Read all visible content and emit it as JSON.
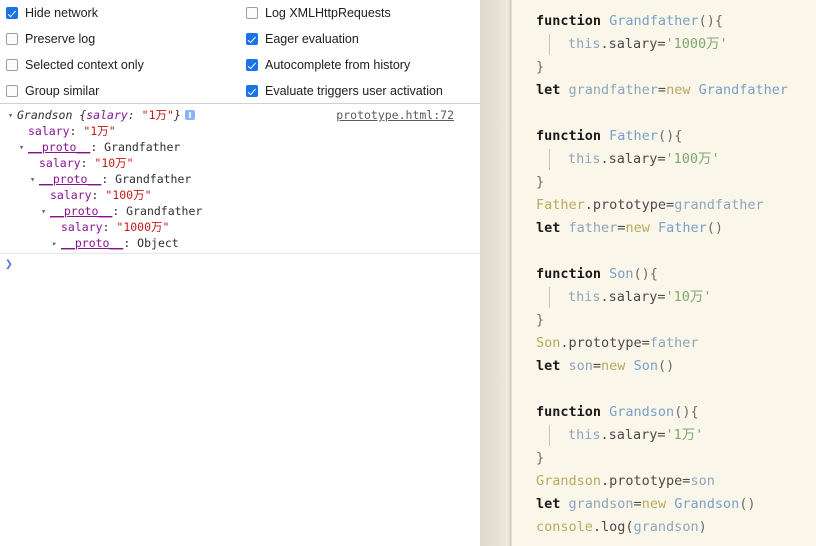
{
  "devtools": {
    "settings": {
      "left_column": [
        {
          "label": "Hide network",
          "checked": true,
          "name": "hide-network"
        },
        {
          "label": "Preserve log",
          "checked": false,
          "name": "preserve-log"
        },
        {
          "label": "Selected context only",
          "checked": false,
          "name": "selected-context-only"
        },
        {
          "label": "Group similar",
          "checked": false,
          "name": "group-similar"
        }
      ],
      "right_column": [
        {
          "label": "Log XMLHttpRequests",
          "checked": false,
          "name": "log-xmlhttprequests"
        },
        {
          "label": "Eager evaluation",
          "checked": true,
          "name": "eager-evaluation"
        },
        {
          "label": "Autocomplete from history",
          "checked": true,
          "name": "autocomplete-from-history"
        },
        {
          "label": "Evaluate triggers user activation",
          "checked": true,
          "name": "evaluate-triggers-user-activation"
        }
      ]
    },
    "log": {
      "source_link": "prototype.html:72",
      "rows": [
        {
          "indent": 0,
          "twisty": "▾",
          "segments": [
            {
              "text": "Grandson ",
              "cls": "obj-name"
            },
            {
              "text": "{",
              "cls": "brace"
            },
            {
              "text": "salary",
              "cls": "prop-key-italic"
            },
            {
              "text": ": ",
              "cls": "brace"
            },
            {
              "text": "\"1万\"",
              "cls": "str-val"
            },
            {
              "text": "}",
              "cls": "brace"
            }
          ],
          "info_icon": true
        },
        {
          "indent": 1,
          "twisty": "",
          "segments": [
            {
              "text": "salary",
              "cls": "prop-key"
            },
            {
              "text": ": ",
              "cls": "proto-val"
            },
            {
              "text": "\"1万\"",
              "cls": "str-val"
            }
          ],
          "info_icon": false
        },
        {
          "indent": 1,
          "twisty": "▾",
          "segments": [
            {
              "text": "__proto__",
              "cls": "proto-key"
            },
            {
              "text": ": ",
              "cls": "proto-val"
            },
            {
              "text": "Grandfather",
              "cls": "proto-val"
            }
          ],
          "info_icon": false
        },
        {
          "indent": 2,
          "twisty": "",
          "segments": [
            {
              "text": "salary",
              "cls": "prop-key"
            },
            {
              "text": ": ",
              "cls": "proto-val"
            },
            {
              "text": "\"10万\"",
              "cls": "str-val"
            }
          ],
          "info_icon": false
        },
        {
          "indent": 2,
          "twisty": "▾",
          "segments": [
            {
              "text": "__proto__",
              "cls": "proto-key"
            },
            {
              "text": ": ",
              "cls": "proto-val"
            },
            {
              "text": "Grandfather",
              "cls": "proto-val"
            }
          ],
          "info_icon": false
        },
        {
          "indent": 3,
          "twisty": "",
          "segments": [
            {
              "text": "salary",
              "cls": "prop-key"
            },
            {
              "text": ": ",
              "cls": "proto-val"
            },
            {
              "text": "\"100万\"",
              "cls": "str-val"
            }
          ],
          "info_icon": false
        },
        {
          "indent": 3,
          "twisty": "▾",
          "segments": [
            {
              "text": "__proto__",
              "cls": "proto-key"
            },
            {
              "text": ": ",
              "cls": "proto-val"
            },
            {
              "text": "Grandfather",
              "cls": "proto-val"
            }
          ],
          "info_icon": false
        },
        {
          "indent": 4,
          "twisty": "",
          "segments": [
            {
              "text": "salary",
              "cls": "prop-key"
            },
            {
              "text": ": ",
              "cls": "proto-val"
            },
            {
              "text": "\"1000万\"",
              "cls": "str-val"
            }
          ],
          "info_icon": false
        },
        {
          "indent": 4,
          "twisty": "▸",
          "segments": [
            {
              "text": "__proto__",
              "cls": "proto-key"
            },
            {
              "text": ": ",
              "cls": "proto-val"
            },
            {
              "text": "Object",
              "cls": "proto-val"
            }
          ],
          "info_icon": false
        }
      ]
    },
    "prompt": {
      "arrow": "❯",
      "value": ""
    }
  },
  "editor": {
    "lines": [
      {
        "indent": 0,
        "guide": false,
        "segments": [
          {
            "text": "function ",
            "cls": "kw"
          },
          {
            "text": "Grandfather",
            "cls": "fn"
          },
          {
            "text": "(){",
            "cls": "punct"
          }
        ]
      },
      {
        "indent": 1,
        "guide": true,
        "segments": [
          {
            "text": "this",
            "cls": "ident"
          },
          {
            "text": ".salary=",
            "cls": "plain"
          },
          {
            "text": "'1000万'",
            "cls": "str"
          }
        ]
      },
      {
        "indent": 0,
        "guide": false,
        "segments": [
          {
            "text": "}",
            "cls": "punct"
          }
        ]
      },
      {
        "indent": 0,
        "guide": false,
        "segments": [
          {
            "text": "let ",
            "cls": "kw"
          },
          {
            "text": "grandfather",
            "cls": "ident"
          },
          {
            "text": "=",
            "cls": "plain"
          },
          {
            "text": "new ",
            "cls": "newkw"
          },
          {
            "text": "Grandfather",
            "cls": "fn"
          }
        ]
      },
      {
        "indent": 0,
        "guide": false,
        "segments": []
      },
      {
        "indent": 0,
        "guide": false,
        "segments": [
          {
            "text": "function ",
            "cls": "kw"
          },
          {
            "text": "Father",
            "cls": "fn"
          },
          {
            "text": "(){",
            "cls": "punct"
          }
        ]
      },
      {
        "indent": 1,
        "guide": true,
        "segments": [
          {
            "text": "this",
            "cls": "ident"
          },
          {
            "text": ".salary=",
            "cls": "plain"
          },
          {
            "text": "'100万'",
            "cls": "str"
          }
        ]
      },
      {
        "indent": 0,
        "guide": false,
        "segments": [
          {
            "text": "}",
            "cls": "punct"
          }
        ]
      },
      {
        "indent": 0,
        "guide": false,
        "segments": [
          {
            "text": "Father",
            "cls": "olive"
          },
          {
            "text": ".prototype=",
            "cls": "plain"
          },
          {
            "text": "grandfather",
            "cls": "ident"
          }
        ]
      },
      {
        "indent": 0,
        "guide": false,
        "segments": [
          {
            "text": "let ",
            "cls": "kw"
          },
          {
            "text": "father",
            "cls": "ident"
          },
          {
            "text": "=",
            "cls": "plain"
          },
          {
            "text": "new ",
            "cls": "newkw"
          },
          {
            "text": "Father",
            "cls": "fn"
          },
          {
            "text": "()",
            "cls": "punct"
          }
        ]
      },
      {
        "indent": 0,
        "guide": false,
        "segments": []
      },
      {
        "indent": 0,
        "guide": false,
        "segments": [
          {
            "text": "function ",
            "cls": "kw"
          },
          {
            "text": "Son",
            "cls": "fn"
          },
          {
            "text": "(){",
            "cls": "punct"
          }
        ]
      },
      {
        "indent": 1,
        "guide": true,
        "segments": [
          {
            "text": "this",
            "cls": "ident"
          },
          {
            "text": ".salary=",
            "cls": "plain"
          },
          {
            "text": "'10万'",
            "cls": "str"
          }
        ]
      },
      {
        "indent": 0,
        "guide": false,
        "segments": [
          {
            "text": "}",
            "cls": "punct"
          }
        ]
      },
      {
        "indent": 0,
        "guide": false,
        "segments": [
          {
            "text": "Son",
            "cls": "olive"
          },
          {
            "text": ".prototype=",
            "cls": "plain"
          },
          {
            "text": "father",
            "cls": "ident"
          }
        ]
      },
      {
        "indent": 0,
        "guide": false,
        "segments": [
          {
            "text": "let ",
            "cls": "kw"
          },
          {
            "text": "son",
            "cls": "ident"
          },
          {
            "text": "=",
            "cls": "plain"
          },
          {
            "text": "new ",
            "cls": "newkw"
          },
          {
            "text": "Son",
            "cls": "fn"
          },
          {
            "text": "()",
            "cls": "punct"
          }
        ]
      },
      {
        "indent": 0,
        "guide": false,
        "segments": []
      },
      {
        "indent": 0,
        "guide": false,
        "segments": [
          {
            "text": "function ",
            "cls": "kw"
          },
          {
            "text": "Grandson",
            "cls": "fn"
          },
          {
            "text": "(){",
            "cls": "punct"
          }
        ]
      },
      {
        "indent": 1,
        "guide": true,
        "segments": [
          {
            "text": "this",
            "cls": "ident"
          },
          {
            "text": ".salary=",
            "cls": "plain"
          },
          {
            "text": "'1万'",
            "cls": "str"
          }
        ]
      },
      {
        "indent": 0,
        "guide": false,
        "segments": [
          {
            "text": "}",
            "cls": "punct"
          }
        ]
      },
      {
        "indent": 0,
        "guide": false,
        "segments": [
          {
            "text": "Grandson",
            "cls": "olive"
          },
          {
            "text": ".prototype=",
            "cls": "plain"
          },
          {
            "text": "son",
            "cls": "ident"
          }
        ]
      },
      {
        "indent": 0,
        "guide": false,
        "segments": [
          {
            "text": "let ",
            "cls": "kw"
          },
          {
            "text": "grandson",
            "cls": "ident"
          },
          {
            "text": "=",
            "cls": "plain"
          },
          {
            "text": "new ",
            "cls": "newkw"
          },
          {
            "text": "Grandson",
            "cls": "fn"
          },
          {
            "text": "()",
            "cls": "punct"
          }
        ]
      },
      {
        "indent": 0,
        "guide": false,
        "segments": [
          {
            "text": "console",
            "cls": "olive"
          },
          {
            "text": ".log(",
            "cls": "plain"
          },
          {
            "text": "grandson",
            "cls": "ident"
          },
          {
            "text": ")",
            "cls": "punct"
          }
        ]
      }
    ]
  },
  "colors": {
    "checkbox_accent": "#1a73e8",
    "editor_bg": "#faf6ea",
    "string_literal": "#7fa86e",
    "console_string": "#c41a16",
    "console_key": "#881391"
  }
}
